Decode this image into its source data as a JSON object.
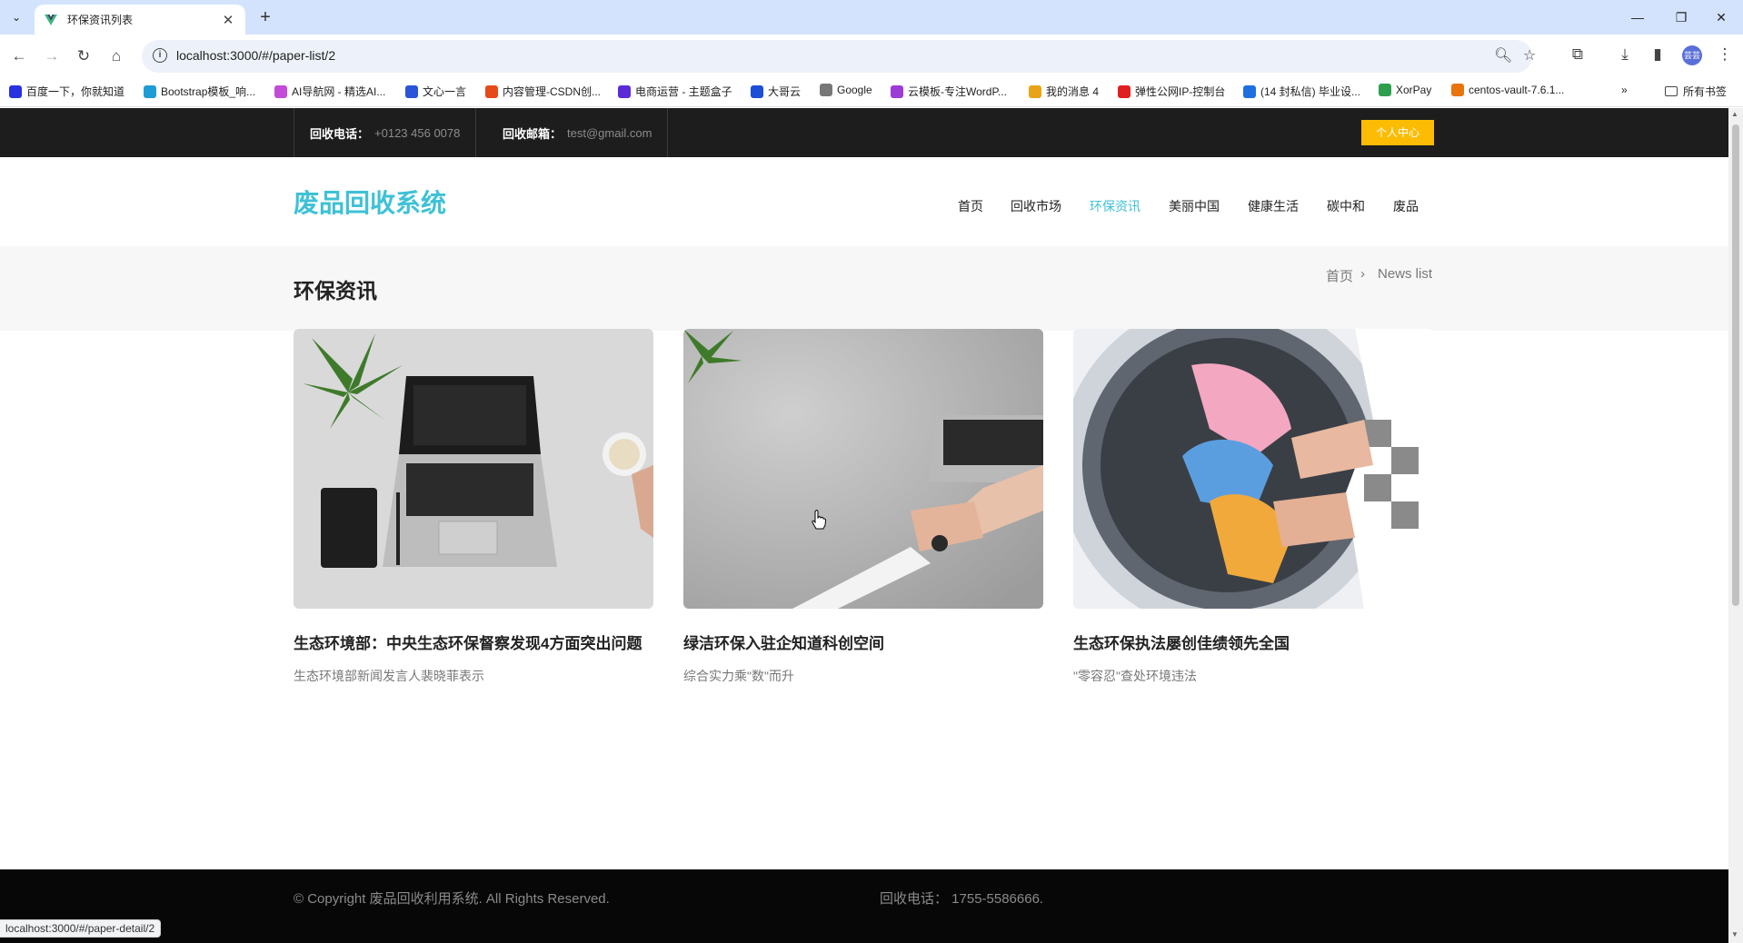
{
  "browser": {
    "tab_title": "环保资讯列表",
    "url": "localhost:3000/#/paper-list/2",
    "bookmarks": [
      {
        "label": "百度一下，你就知道",
        "color": "#2932e1"
      },
      {
        "label": "Bootstrap模板_响...",
        "color": "#1f9bd6"
      },
      {
        "label": "AI导航网 - 精选AI...",
        "color": "#c44bd8"
      },
      {
        "label": "文心一言",
        "color": "#2b55d8"
      },
      {
        "label": "内容管理-CSDN创...",
        "color": "#e64a19"
      },
      {
        "label": "电商运营 - 主题盒子",
        "color": "#5b2bd8"
      },
      {
        "label": "大哥云",
        "color": "#1d4ed8"
      },
      {
        "label": "Google",
        "color": "#777777"
      },
      {
        "label": "云模板-专注WordP...",
        "color": "#9c3bd8"
      },
      {
        "label": "我的消息 4",
        "color": "#e8a317"
      },
      {
        "label": "弹性公网IP-控制台",
        "color": "#e02020"
      },
      {
        "label": "(14 封私信) 毕业设...",
        "color": "#1f6fe0"
      },
      {
        "label": "XorPay",
        "color": "#2e9e4e"
      },
      {
        "label": "centos-vault-7.6.1...",
        "color": "#e8740c"
      }
    ],
    "all_bookmarks": "所有书签",
    "status_url": "localhost:3000/#/paper-detail/2",
    "profile_initials": "芸芸"
  },
  "topbar": {
    "phone_label": "回收电话：",
    "phone_value": "+0123 456 0078",
    "email_label": "回收邮箱：",
    "email_value": "test@gmail.com",
    "user_center": "个人中心"
  },
  "header": {
    "logo": "废品回收系统",
    "nav": [
      "首页",
      "回收市场",
      "环保资讯",
      "美丽中国",
      "健康生活",
      "碳中和",
      "废品"
    ],
    "active_nav": "环保资讯"
  },
  "breadcrumb": {
    "title": "环保资讯",
    "home": "首页",
    "separator": "›",
    "current": "News list"
  },
  "articles": [
    {
      "title": "生态环境部：中央生态环保督察发现4方面突出问题",
      "desc": "生态环境部新闻发言人裴晓菲表示",
      "image": "laptop-desk-photo"
    },
    {
      "title": "绿洁环保入驻企知道科创空间",
      "desc": "综合实力乘\"数\"而升",
      "image": "hands-laptop-desk-photo"
    },
    {
      "title": "生态环保执法屡创佳绩领先全国",
      "desc": "\"零容忍\"查处环境违法",
      "image": "washing-machine-laundry-photo"
    }
  ],
  "footer": {
    "copyright": "© Copyright 废品回收利用系统. All Rights Reserved.",
    "phone": "回收电话：  1755-5586666."
  },
  "colors": {
    "accent": "#3ec1d5",
    "topbar_bg": "#1d1d1d",
    "user_center_bg": "#fcbc03",
    "footer_bg": "#070707"
  }
}
